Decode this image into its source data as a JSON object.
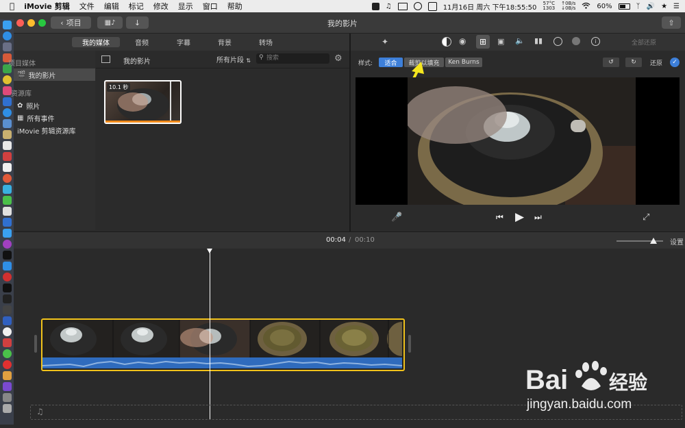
{
  "menubar": {
    "app": "iMovie 剪辑",
    "items": [
      "文件",
      "编辑",
      "标记",
      "修改",
      "显示",
      "窗口",
      "帮助"
    ],
    "clock": "11月16日 周六 下午18:55:50",
    "temp": "57°C",
    "rpm": "1303",
    "net_up": "0B/s",
    "net_down": "0B/s",
    "battery": "60%"
  },
  "titlebar": {
    "back_label": "项目",
    "title": "我的影片"
  },
  "browser": {
    "tabs": [
      "我的媒体",
      "音频",
      "字幕",
      "背景",
      "转场"
    ],
    "lib_section_1": "项目媒体",
    "lib_item_movie": "我的影片",
    "lib_section_2": "资源库",
    "lib_item_photos": "照片",
    "lib_item_events": "所有事件",
    "lib_item_library": "iMovie 剪辑资源库",
    "header_title": "我的影片",
    "filter": "所有片段",
    "search_placeholder": "搜索",
    "clip_duration": "10.1 秒"
  },
  "viewer": {
    "reset_all": "全部还原",
    "style_label": "样式:",
    "style_fit": "适合",
    "style_crop": "裁剪以填充",
    "style_kb": "Ken Burns",
    "reset": "还原"
  },
  "timeline": {
    "current": "00:04",
    "sep": "/",
    "total": "00:10",
    "settings": "设置",
    "zoom": 0.8
  },
  "watermark": {
    "site": "jingyan.baidu.com"
  },
  "colors": {
    "accent": "#3d7fd9",
    "clip_border": "#f2c31b",
    "audio": "#2f6bbd",
    "arrow": "#f5e61e"
  }
}
